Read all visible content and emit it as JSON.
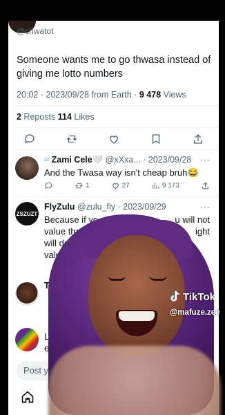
{
  "header": {
    "handle": "@chwatot"
  },
  "main_tweet": {
    "text": "Someone wants me to go thwasa instead of giving me lotto numbers",
    "time": "20:02 · 2023/09/28 from Earth · ",
    "views_count": "9 478",
    "views_label": " Views",
    "reposts_count": "2",
    "reposts_label": " Reposts  ",
    "likes_count": "114",
    "likes_label": " Likes"
  },
  "replies": [
    {
      "name": "Zami Cele🤍",
      "handle": "@xXxa...",
      "date": "2023/09/28",
      "text": "And the Twasa way isn't cheap bruh😂",
      "reposts": "1",
      "likes": "27",
      "views": "9 173"
    },
    {
      "name": "FlyZulu",
      "handle": "@zulu_fly",
      "date": "2023/09/29",
      "avatar_text": "ZSZUZT",
      "line1": "Because if yo",
      "line1_right": "u will not",
      "line2": "value tha",
      "line2_right": "ight",
      "line3": "will de",
      "line4": "valu"
    },
    {
      "name": "T"
    },
    {
      "line1": "L",
      "line2": "ex"
    }
  ],
  "post_bar": {
    "placeholder": "Post yo"
  },
  "overlay": {
    "brand": "TikTok",
    "username": "@mafuze.zee"
  },
  "colors": {
    "accent": "#1d9bf0",
    "muted": "#536471",
    "hair": "#5f2c80"
  }
}
